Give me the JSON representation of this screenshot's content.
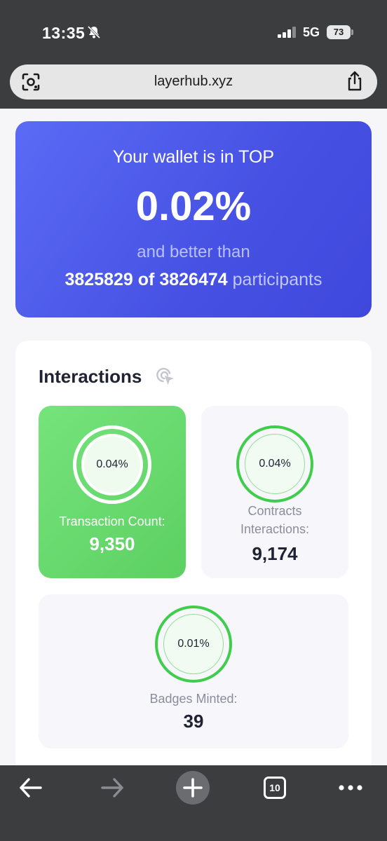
{
  "status_bar": {
    "time": "13:35",
    "network": "5G",
    "battery": "73"
  },
  "browser": {
    "url": "layerhub.xyz",
    "tab_count": "10"
  },
  "hero": {
    "line1": "Your wallet is in TOP",
    "percent": "0.02%",
    "line3": "and better than",
    "rank": "3825829",
    "of_word": "of",
    "total": "3826474",
    "participants_word": "participants"
  },
  "interactions": {
    "title": "Interactions",
    "tiles": [
      {
        "percent": "0.04%",
        "label": "Transaction Count:",
        "value": "9,350"
      },
      {
        "percent": "0.04%",
        "label_line1": "Contracts",
        "label_line2": "Interactions:",
        "value": "9,174"
      },
      {
        "percent": "0.01%",
        "label": "Badges Minted:",
        "value": "39"
      }
    ]
  },
  "colors": {
    "accent": "#4a57e6",
    "green": "#5dd062",
    "ring": "#3fcd4c",
    "chrome": "#3b3d3f"
  },
  "icons": [
    "bell-slash-icon",
    "signal-icon",
    "battery-icon",
    "lens-icon",
    "share-icon",
    "cursor-click-icon",
    "back-arrow-icon",
    "forward-arrow-icon",
    "plus-icon",
    "tabs-icon",
    "more-icon"
  ]
}
